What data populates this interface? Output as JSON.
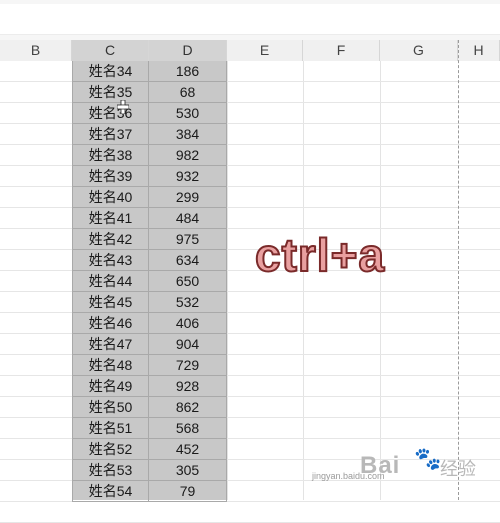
{
  "columns": [
    "B",
    "C",
    "D",
    "E",
    "F",
    "G",
    "H"
  ],
  "selected_columns": [
    "C",
    "D"
  ],
  "rows": [
    {
      "name": "姓名34",
      "value": "186"
    },
    {
      "name": "姓名35",
      "value": "68"
    },
    {
      "name": "姓名36",
      "value": "530"
    },
    {
      "name": "姓名37",
      "value": "384"
    },
    {
      "name": "姓名38",
      "value": "982"
    },
    {
      "name": "姓名39",
      "value": "932"
    },
    {
      "name": "姓名40",
      "value": "299"
    },
    {
      "name": "姓名41",
      "value": "484"
    },
    {
      "name": "姓名42",
      "value": "975"
    },
    {
      "name": "姓名43",
      "value": "634"
    },
    {
      "name": "姓名44",
      "value": "650"
    },
    {
      "name": "姓名45",
      "value": "532"
    },
    {
      "name": "姓名46",
      "value": "406"
    },
    {
      "name": "姓名47",
      "value": "904"
    },
    {
      "name": "姓名48",
      "value": "729"
    },
    {
      "name": "姓名49",
      "value": "928"
    },
    {
      "name": "姓名50",
      "value": "862"
    },
    {
      "name": "姓名51",
      "value": "568"
    },
    {
      "name": "姓名52",
      "value": "452"
    },
    {
      "name": "姓名53",
      "value": "305"
    },
    {
      "name": "姓名54",
      "value": "79"
    }
  ],
  "overlay": {
    "shortcut_text": "ctrl+a"
  },
  "watermark": {
    "logo": "Bai",
    "paw": "🐾",
    "cn": "经验",
    "url": "jingyan.baidu.com"
  },
  "colors": {
    "selection": "#c8c8c8",
    "overlay_fill": "#e9a0a0",
    "overlay_stroke": "#7a2a2a"
  },
  "cursor": {
    "icon": "cross-cursor-icon"
  }
}
